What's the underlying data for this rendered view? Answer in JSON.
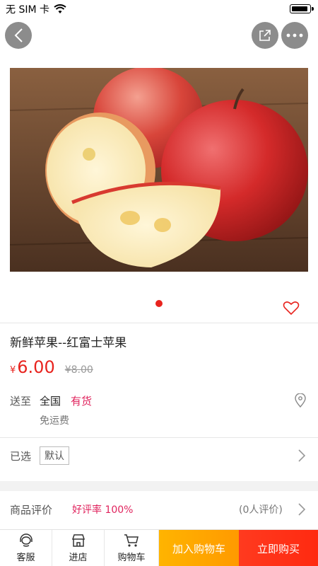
{
  "status_bar": {
    "carrier": "无 SIM 卡"
  },
  "header": {
    "back_icon": "chevron-left-icon",
    "share_icon": "share-icon",
    "more_icon": "more-dots-icon"
  },
  "carousel": {
    "active_index": 1,
    "total": 1
  },
  "product": {
    "title": "新鲜苹果--红富士苹果",
    "currency_symbol": "¥",
    "price": "6.00",
    "original_price": "¥8.00"
  },
  "shipping": {
    "label": "送至",
    "region": "全国",
    "stock_status": "有货",
    "fee": "免运费"
  },
  "selection": {
    "label": "已选",
    "value": "默认"
  },
  "reviews": {
    "label": "商品评价",
    "rating": "好评率 100%",
    "count": "(0人评价)"
  },
  "bottom_bar": {
    "service_label": "客服",
    "store_label": "进店",
    "cart_label": "购物车",
    "add_to_cart": "加入购物车",
    "buy_now": "立即购买"
  },
  "colors": {
    "price_red": "#e8231e",
    "accent_pink": "#e0245e",
    "cart_orange": "#ffa800",
    "buy_red": "#ff3a1f"
  }
}
